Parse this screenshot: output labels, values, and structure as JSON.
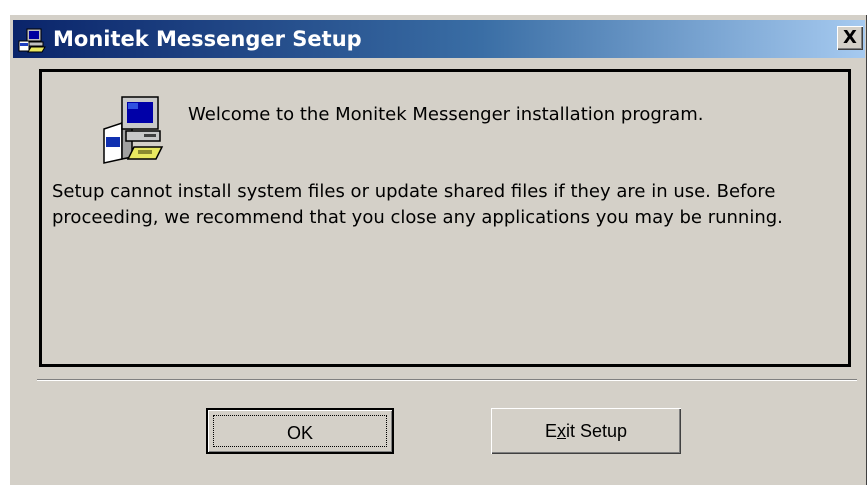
{
  "window": {
    "title": "Monitek Messenger Setup",
    "close_label": "X"
  },
  "content": {
    "welcome": "Welcome to the Monitek Messenger installation program.",
    "body": "Setup cannot install system files or update shared files if they are in use. Before proceeding, we recommend that you close any applications you may be running."
  },
  "buttons": {
    "ok_label": "OK",
    "exit_prefix": "E",
    "exit_accel": "x",
    "exit_suffix": "it Setup"
  },
  "icons": {
    "title": "setup-computer-icon",
    "main": "setup-computer-icon",
    "close": "close-icon"
  },
  "colors": {
    "titlebar_start": "#0a246a",
    "titlebar_end": "#a6caf0",
    "dialog_bg": "#d4d0c8"
  }
}
